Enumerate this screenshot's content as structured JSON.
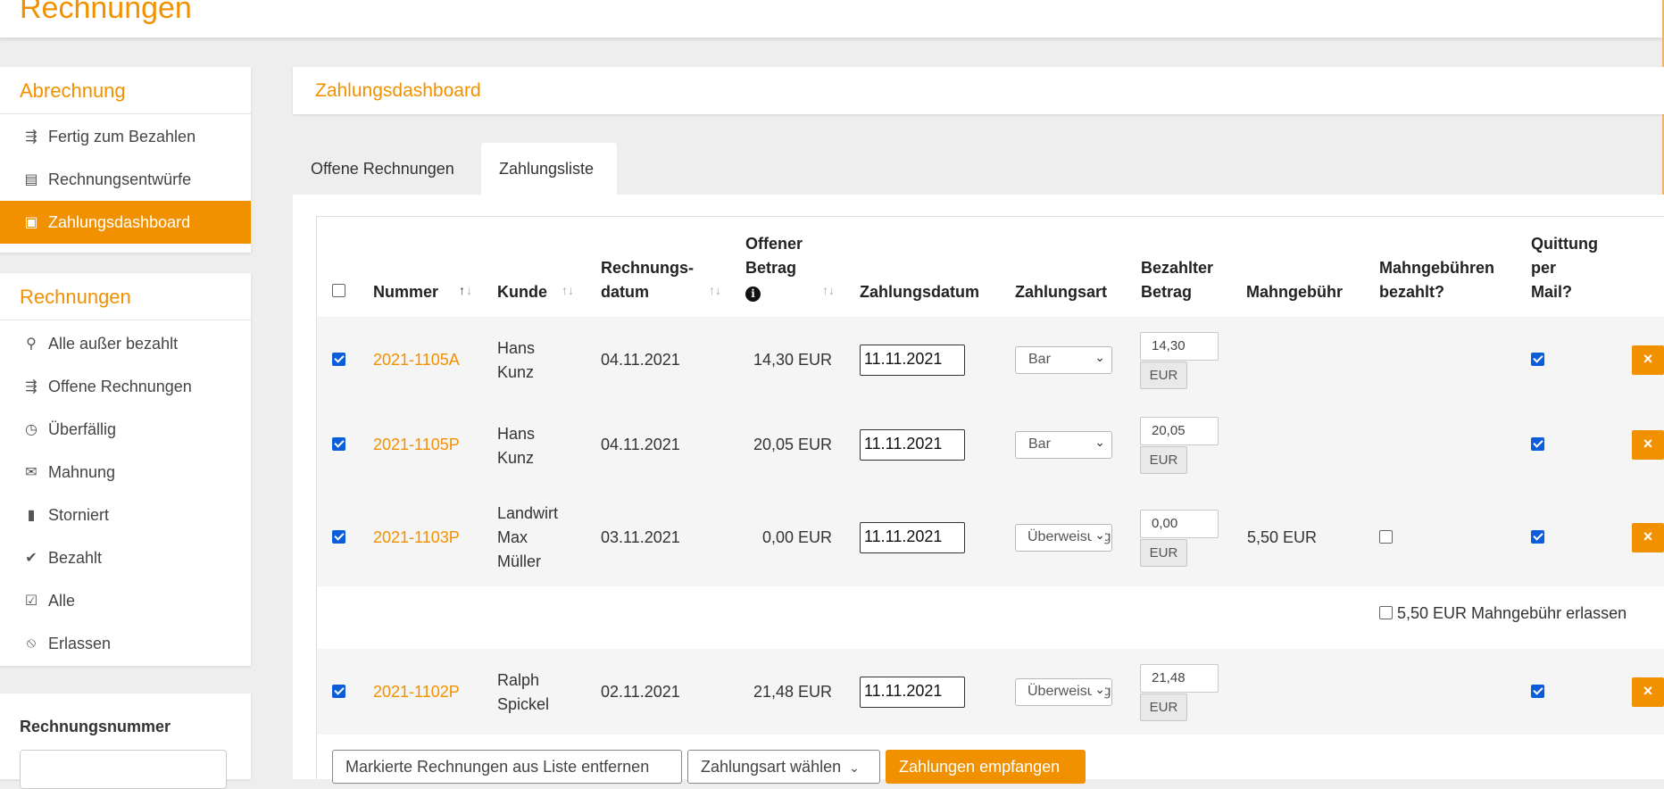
{
  "header": {
    "title": "Rechnungen"
  },
  "sidebar": {
    "billing": {
      "heading": "Abrechnung",
      "items": [
        {
          "label": "Fertig zum Bezahlen",
          "icon": "invoice-send-icon",
          "glyph": "⇶",
          "active": false
        },
        {
          "label": "Rechnungsentwürfe",
          "icon": "draft-document-icon",
          "glyph": "▤",
          "active": false
        },
        {
          "label": "Zahlungsdashboard",
          "icon": "money-bill-icon",
          "glyph": "▣",
          "active": true
        }
      ]
    },
    "invoices": {
      "heading": "Rechnungen",
      "items": [
        {
          "label": "Alle außer bezahlt",
          "icon": "search-icon",
          "glyph": "⚲"
        },
        {
          "label": "Offene Rechnungen",
          "icon": "open-invoice-icon",
          "glyph": "⇶"
        },
        {
          "label": "Überfällig",
          "icon": "overdue-clock-icon",
          "glyph": "◷"
        },
        {
          "label": "Mahnung",
          "icon": "reminder-envelope-icon",
          "glyph": "✉"
        },
        {
          "label": "Storniert",
          "icon": "clipboard-icon",
          "glyph": "▮"
        },
        {
          "label": "Bezahlt",
          "icon": "paid-check-icon",
          "glyph": "✔"
        },
        {
          "label": "Alle",
          "icon": "checkbox-all-icon",
          "glyph": "☑"
        },
        {
          "label": "Erlassen",
          "icon": "ban-icon",
          "glyph": "⦸"
        }
      ]
    },
    "search": {
      "label": "Rechnungsnummer",
      "value": ""
    }
  },
  "main": {
    "heading": "Zahlungsdashboard",
    "tabs": [
      {
        "label": "Offene Rechnungen",
        "active": false
      },
      {
        "label": "Zahlungsliste",
        "active": true
      }
    ]
  },
  "table": {
    "headers": {
      "nummer": "Nummer",
      "kunde": "Kunde",
      "rechnungsdatum_1": "Rechnungs-",
      "rechnungsdatum_2": "datum",
      "offener_1": "Offener",
      "offener_2": "Betrag",
      "zahlungsdatum": "Zahlungsdatum",
      "zahlungsart": "Zahlungsart",
      "bezahlter_1": "Bezahlter",
      "bezahlter_2": "Betrag",
      "mahngebuehr": "Mahngebühr",
      "mahngeb_bez_1": "Mahngebühren",
      "mahngeb_bez_2": "bezahlt?",
      "quittung_1": "Quittung",
      "quittung_2": "per",
      "quittung_3": "Mail?"
    },
    "sort_up": "↑",
    "sort_down": "↓",
    "sort_both": "↑↓",
    "info_glyph": "i",
    "close_glyph": "×",
    "chevron": "⌄",
    "rows": [
      {
        "nummer": "2021-1105A",
        "kunde_1": "Hans",
        "kunde_2": "Kunz",
        "kunde_3": "",
        "datum": "04.11.2021",
        "offen": "14,30 EUR",
        "zahlungsdatum": "11.11.2021",
        "zahlungsart": "Bar",
        "betrag": "14,30",
        "currency": "EUR",
        "mahngebuehr": "",
        "quittung": true
      },
      {
        "nummer": "2021-1105P",
        "kunde_1": "Hans",
        "kunde_2": "Kunz",
        "kunde_3": "",
        "datum": "04.11.2021",
        "offen": "20,05 EUR",
        "zahlungsdatum": "11.11.2021",
        "zahlungsart": "Bar",
        "betrag": "20,05",
        "currency": "EUR",
        "mahngebuehr": "",
        "quittung": true
      },
      {
        "nummer": "2021-1103P",
        "kunde_1": "Landwirt",
        "kunde_2": "Max",
        "kunde_3": "Müller",
        "datum": "03.11.2021",
        "offen": "0,00 EUR",
        "zahlungsdatum": "11.11.2021",
        "zahlungsart": "Überweisung",
        "betrag": "0,00",
        "currency": "EUR",
        "mahngebuehr": "5,50 EUR",
        "quittung": true,
        "waive_label": "5,50 EUR Mahngebühr erlassen"
      },
      {
        "nummer": "2021-1102P",
        "kunde_1": "Ralph",
        "kunde_2": "Spickel",
        "kunde_3": "",
        "datum": "02.11.2021",
        "offen": "21,48 EUR",
        "zahlungsdatum": "11.11.2021",
        "zahlungsart": "Überweisung",
        "betrag": "21,48",
        "currency": "EUR",
        "mahngebuehr": "",
        "quittung": true
      }
    ]
  },
  "actions": {
    "remove_label": "Markierte Rechnungen aus Liste entfernen",
    "payment_type_label": "Zahlungsart wählen",
    "receive_label": "Zahlungen empfangen"
  },
  "colors": {
    "accent": "#f29100",
    "checkbox": "#0b5ed7",
    "row_bg": "#f5f5f5"
  }
}
